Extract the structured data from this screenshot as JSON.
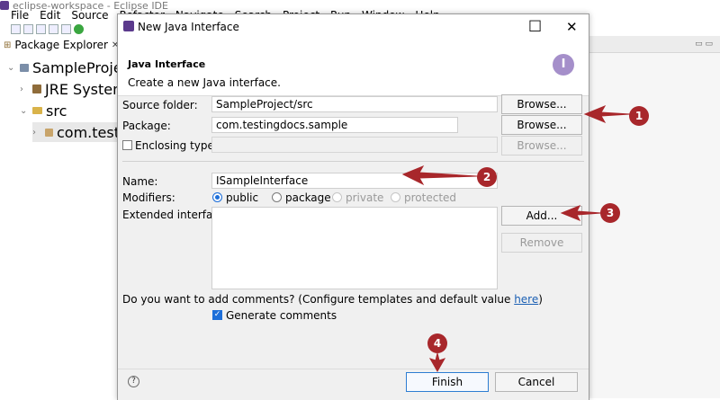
{
  "ide": {
    "title": "eclipse-workspace - Eclipse IDE",
    "menu": [
      "File",
      "Edit",
      "Source",
      "Refactor",
      "Navigate",
      "Search",
      "Project",
      "Run",
      "Window",
      "Help"
    ],
    "package_explorer_tab": "Package Explorer",
    "tree": [
      {
        "label": "SampleProject",
        "level": 0
      },
      {
        "label": "JRE System Library",
        "level": 1
      },
      {
        "label": "src",
        "level": 1
      },
      {
        "label": "com.testingdocs.sample",
        "level": 2
      }
    ]
  },
  "dialog": {
    "title": "New Java Interface",
    "header_title": "Java Interface",
    "header_subtitle": "Create a new Java interface.",
    "source_folder_label": "Source folder:",
    "source_folder_value": "SampleProject/src",
    "package_label": "Package:",
    "package_value": "com.testingdocs.sample",
    "enclosing_type_label": "Enclosing type:",
    "enclosing_type_value": "",
    "name_label": "Name:",
    "name_value": "ISampleInterface",
    "modifiers_label": "Modifiers:",
    "modifiers": [
      {
        "label": "public",
        "selected": true,
        "enabled": true
      },
      {
        "label": "package",
        "selected": false,
        "enabled": true
      },
      {
        "label": "private",
        "selected": false,
        "enabled": false
      },
      {
        "label": "protected",
        "selected": false,
        "enabled": false
      }
    ],
    "extended_interfaces_label": "Extended interfaces:",
    "browse_label": "Browse...",
    "add_label": "Add...",
    "remove_label": "Remove",
    "comments_question": "Do you want to add comments? (Configure templates and default value ",
    "comments_link": "here",
    "comments_suffix": ")",
    "generate_comments_label": "Generate comments",
    "generate_comments_checked": true,
    "finish_label": "Finish",
    "cancel_label": "Cancel"
  },
  "annotations": {
    "badges": [
      "1",
      "2",
      "3",
      "4"
    ],
    "arrow_color": "#a8272b"
  }
}
